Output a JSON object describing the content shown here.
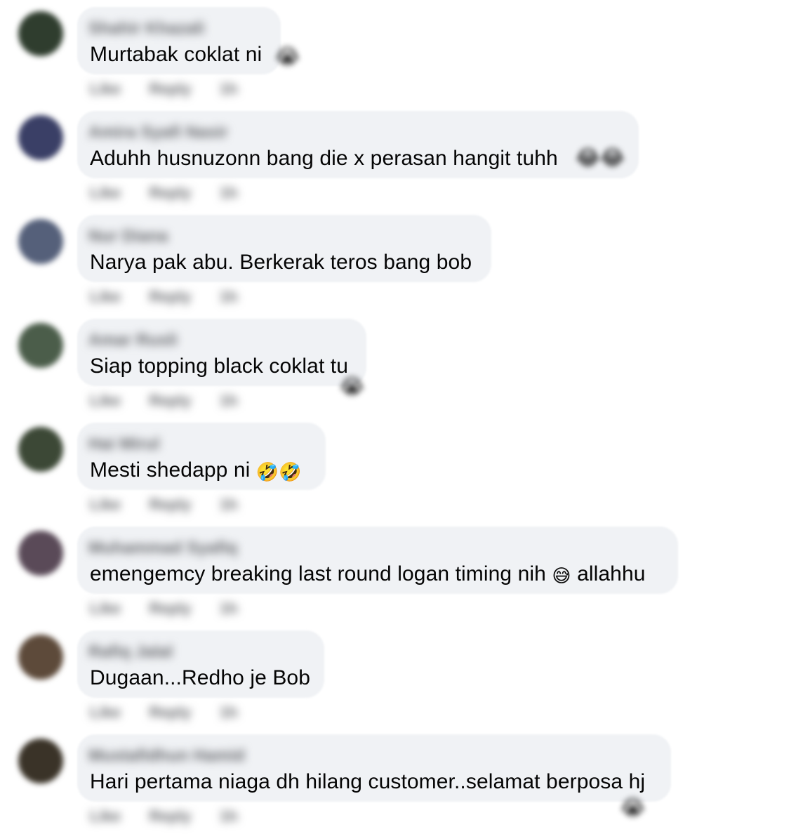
{
  "comments": [
    {
      "author": "Shahir Khazali",
      "text": "Murtabak coklat ni",
      "trailing_emoji": "😭",
      "avatar_color": "#2f3d2e",
      "actions": [
        "Like",
        "Reply",
        "1h"
      ]
    },
    {
      "author": "Amira Syafi Nasir",
      "text": "Aduhh husnuzonn bang die x perasan hangit tuhh",
      "trailing_emoji": "😂😂",
      "avatar_color": "#3a3f66",
      "actions": [
        "Like",
        "Reply",
        "1h"
      ]
    },
    {
      "author": "Nur Diana",
      "text": "Narya pak abu. Berkerak teros bang bob",
      "trailing_emoji": "",
      "avatar_color": "#55607a",
      "actions": [
        "Like",
        "Reply",
        "1h"
      ]
    },
    {
      "author": "Amar Rusli",
      "text": "Siap topping black coklat tu",
      "trailing_emoji": "😭",
      "avatar_color": "#4b5d4a",
      "actions": [
        "Like",
        "Reply",
        "1h"
      ]
    },
    {
      "author": "Hai Mirul",
      "text": "Mesti shedapp ni",
      "trailing_emoji": "🤣🤣",
      "avatar_color": "#3c4836",
      "actions": [
        "Like",
        "Reply",
        "1h"
      ]
    },
    {
      "author": "Muhammad Syafiq",
      "text": "emengemcy breaking last round logan timing nih",
      "inline_emoji": "😅",
      "text_after": "allahhu",
      "avatar_color": "#5a4a58",
      "actions": [
        "Like",
        "Reply",
        "1h"
      ]
    },
    {
      "author": "Rafiq Jalal",
      "text": "Dugaan...Redho je Bob",
      "trailing_emoji": "",
      "avatar_color": "#5d4a3a",
      "actions": [
        "Like",
        "Reply",
        "1h"
      ]
    },
    {
      "author": "Mustafidhun Hamid",
      "text": "Hari pertama niaga dh hilang customer..selamat berposa hj",
      "trailing_emoji": "😭",
      "avatar_color": "#3a3328",
      "actions": [
        "Like",
        "Reply",
        "1h"
      ]
    }
  ]
}
